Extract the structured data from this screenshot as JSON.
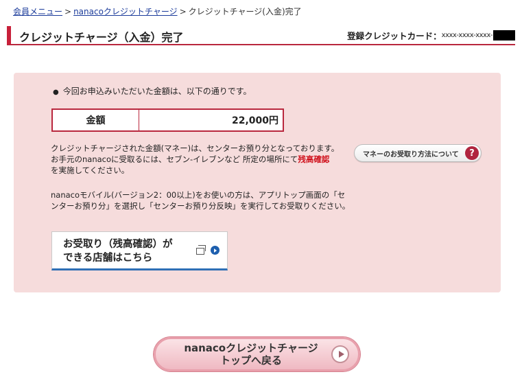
{
  "breadcrumb": {
    "items": [
      "会員メニュー",
      "nanacoクレジットチャージ"
    ],
    "current": "クレジットチャージ(入金)完了",
    "separator": ">"
  },
  "header": {
    "title": "クレジットチャージ（入金）完了",
    "card_label": "登録クレジットカード：",
    "card_masked": "xxxx-xxxx-xxxx-"
  },
  "notice": {
    "bullet_text": "今回お申込みいただいた金額は、以下の通りです。"
  },
  "amount": {
    "label": "金額",
    "value": "22,000円"
  },
  "info": {
    "para1_line1": "クレジットチャージされた金額(マネー)は、センターお預り分となっております。",
    "para1_line2a": "お手元のnanacoに受取るには、セブン-イレブンなど 所定の場所にて",
    "para1_line2_red": "残高確認",
    "para1_line3": "を実施してください。",
    "para2_line1": "nanacoモバイル(バージョン2：00以上)をお使いの方は、アプリトップ画面の「セ",
    "para2_line2": "ンターお預り分」を選択し「センターお預り分反映」を実行してお受取りください。"
  },
  "help_button": {
    "label": "マネーのお受取り方法について",
    "icon": "?"
  },
  "store_button": {
    "line1": "お受取り（残高確認）が",
    "line2": "できる店舗はこちら"
  },
  "top_button": {
    "line1": "nanacoクレジットチャージ",
    "line2": "トップへ戻る"
  },
  "colors": {
    "accent": "#c8203a",
    "panel_bg": "#f6dcdc",
    "link": "#1a3a9a",
    "highlight": "#d0121d"
  }
}
